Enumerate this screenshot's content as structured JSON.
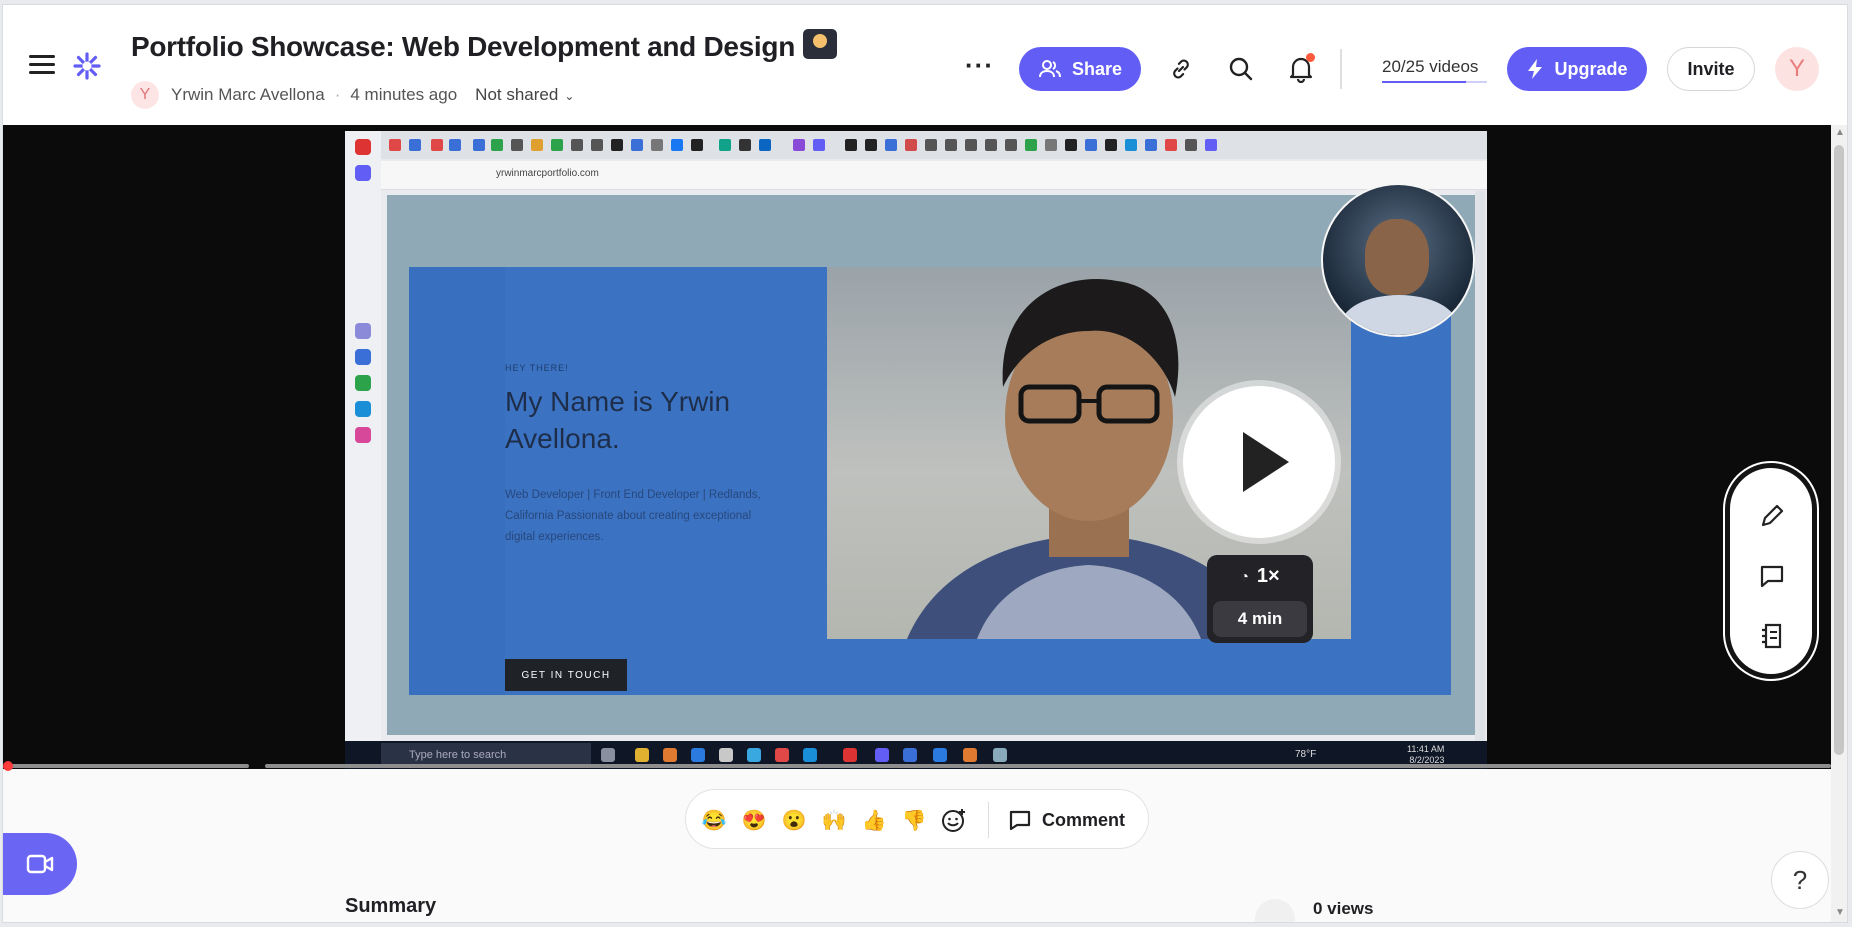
{
  "header": {
    "title": "Portfolio Showcase: Web Development and Design",
    "author_initial": "Y",
    "author_name": "Yrwin Marc Avellona",
    "time_ago": "4 minutes ago",
    "share_state": "Not shared",
    "share_label": "Share",
    "videos_count": "20/25 videos",
    "upgrade_label": "Upgrade",
    "invite_label": "Invite",
    "user_initial": "Y",
    "accent_color": "#625df5"
  },
  "video": {
    "url": "yrwinmarcportfolio.com",
    "hey_there": "HEY THERE!",
    "hero_name": "My Name is Yrwin Avellona.",
    "hero_bio": "Web Developer | Front End Developer | Redlands, California Passionate about creating exceptional digital experiences.",
    "cta": "GET IN TOUCH",
    "taskbar_search": "Type here to search",
    "weather": "78°F",
    "clock_time": "11:41 AM",
    "clock_date": "8/2/2023",
    "speed": "1×",
    "duration": "4 min"
  },
  "reactions": {
    "items": [
      "😂",
      "😍",
      "😮",
      "🙌",
      "👍",
      "👎"
    ],
    "comment_label": "Comment"
  },
  "below": {
    "summary_label": "Summary",
    "views_label": "0 views",
    "help_label": "?"
  }
}
